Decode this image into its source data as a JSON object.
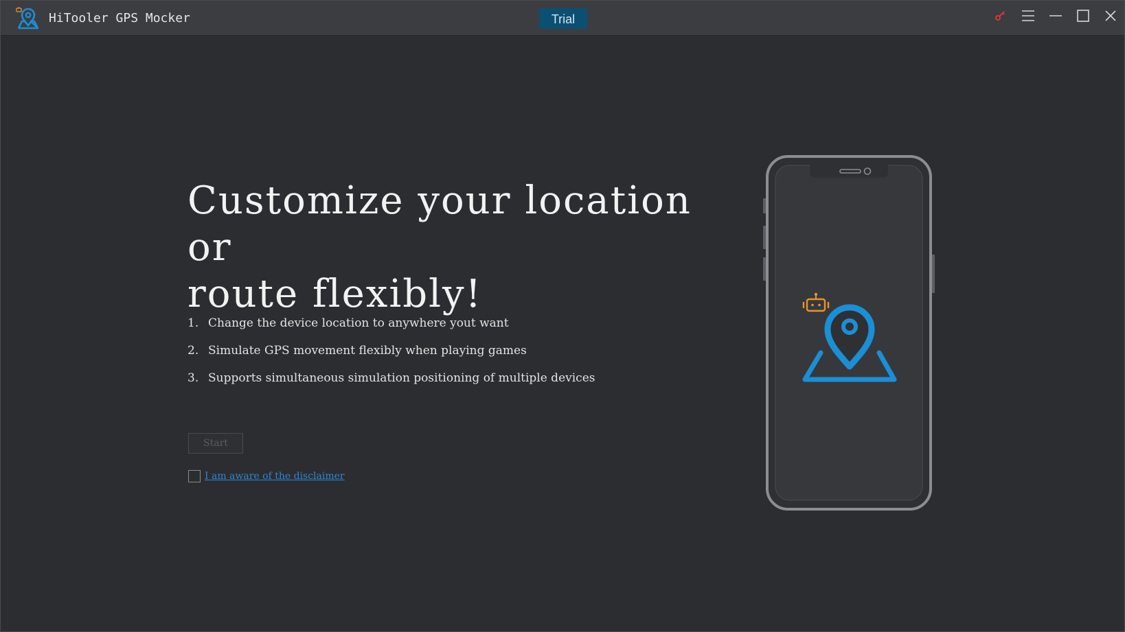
{
  "app": {
    "title": "HiTooler GPS Mocker",
    "logo_icon": "location-pin-map-icon"
  },
  "titlebar": {
    "trial_label": "Trial",
    "key_icon": "key-icon",
    "menu_icon": "hamburger-menu-icon",
    "minimize_icon": "minimize-icon",
    "maximize_icon": "maximize-icon",
    "close_icon": "close-icon"
  },
  "main": {
    "headline_line1": "Customize your location or",
    "headline_line2": "route flexibly!",
    "features": [
      {
        "num": "1.",
        "text": "Change the device location to anywhere yout want"
      },
      {
        "num": "2.",
        "text": "Simulate GPS movement flexibly when playing games"
      },
      {
        "num": "3.",
        "text": "Supports simultaneous simulation positioning of multiple devices"
      }
    ],
    "start_label": "Start",
    "disclaimer_label": "I am aware of the disclaimer",
    "disclaimer_checked": false
  },
  "illustration": {
    "device_icon": "smartphone-icon",
    "robot_icon": "android-robot-icon",
    "pin_icon": "map-pin-icon"
  },
  "colors": {
    "background": "#2c2d30",
    "titlebar": "#3c3d41",
    "accent_blue": "#1b8fd6",
    "accent_orange": "#e8952a",
    "trial_bg": "#0b4f73",
    "key_red": "#d93535"
  }
}
